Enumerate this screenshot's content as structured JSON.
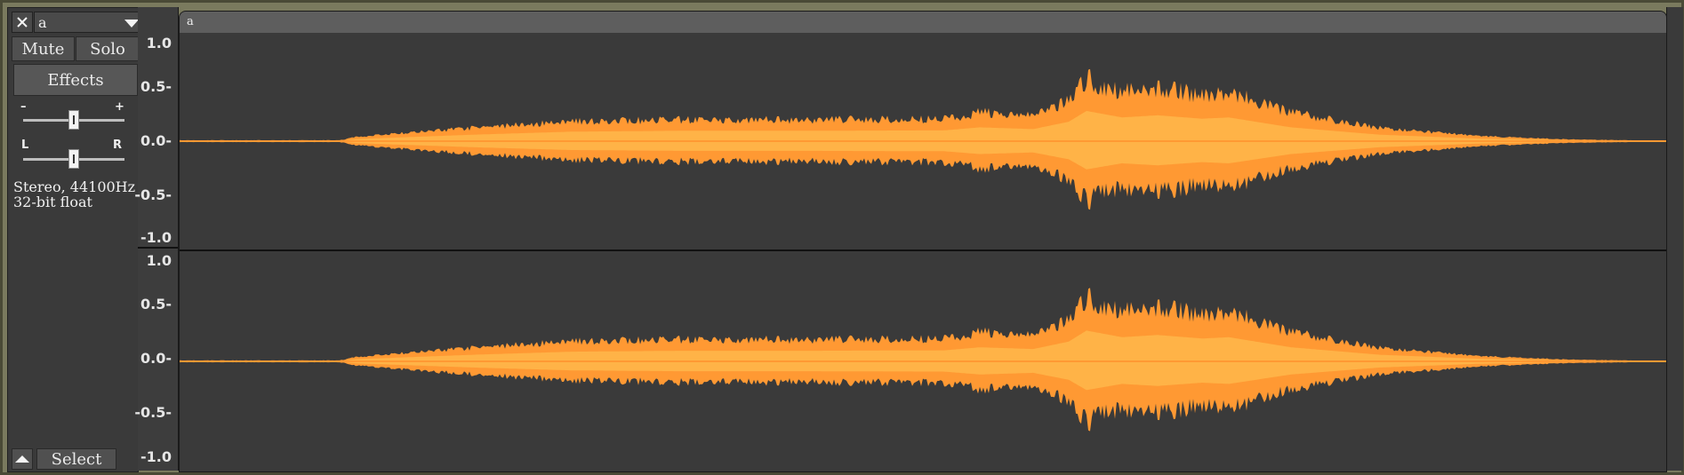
{
  "track": {
    "name": "a",
    "close_icon": "close-icon",
    "menu_icon": "chevron-down-icon",
    "mute_label": "Mute",
    "solo_label": "Solo",
    "effects_label": "Effects",
    "gain": {
      "minus_label": "–",
      "plus_label": "+",
      "value": 0.5
    },
    "pan": {
      "left_label": "L",
      "right_label": "R",
      "value": 0.5
    },
    "info_line1": "Stereo, 44100Hz",
    "info_line2": "32-bit float",
    "collapse_icon": "collapse-up-icon",
    "select_label": "Select"
  },
  "clip": {
    "name": "a"
  },
  "ruler": {
    "top_channel": [
      "1.0",
      "0.5-",
      "0.0-",
      "-0.5-",
      "-1.0"
    ],
    "bottom_channel": [
      "1.0",
      "0.5-",
      "0.0-",
      "-0.5-",
      "-1.0"
    ]
  },
  "colors": {
    "waveform_outer": "#ff9933",
    "waveform_inner": "#ffb347",
    "background": "#3a3a3a"
  }
}
